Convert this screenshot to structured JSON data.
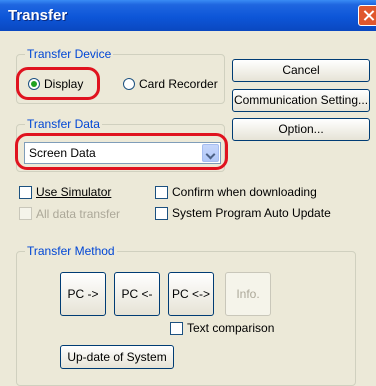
{
  "window": {
    "title": "Transfer"
  },
  "transfer_device": {
    "legend": "Transfer Device",
    "options": [
      "Display",
      "Card Recorder"
    ],
    "selected": "Display"
  },
  "buttons": {
    "cancel": "Cancel",
    "communication_setting": "Communication Setting...",
    "option": "Option...",
    "pc_to": "PC ->",
    "pc_from": "PC <-",
    "pc_compare": "PC <->",
    "info": "Info.",
    "update_system": "Up-date of System"
  },
  "transfer_data": {
    "legend": "Transfer Data",
    "selected": "Screen Data"
  },
  "checkboxes": {
    "use_simulator": "Use Simulator",
    "all_data_transfer": "All data transfer",
    "confirm_when_downloading": "Confirm when downloading",
    "system_program_auto_update": "System Program Auto Update",
    "text_comparison": "Text comparison"
  },
  "transfer_method": {
    "legend": "Transfer Method"
  },
  "colors": {
    "highlight": "#e0131f",
    "title_bar": "#0d56d8",
    "group_label": "#0046d5"
  }
}
